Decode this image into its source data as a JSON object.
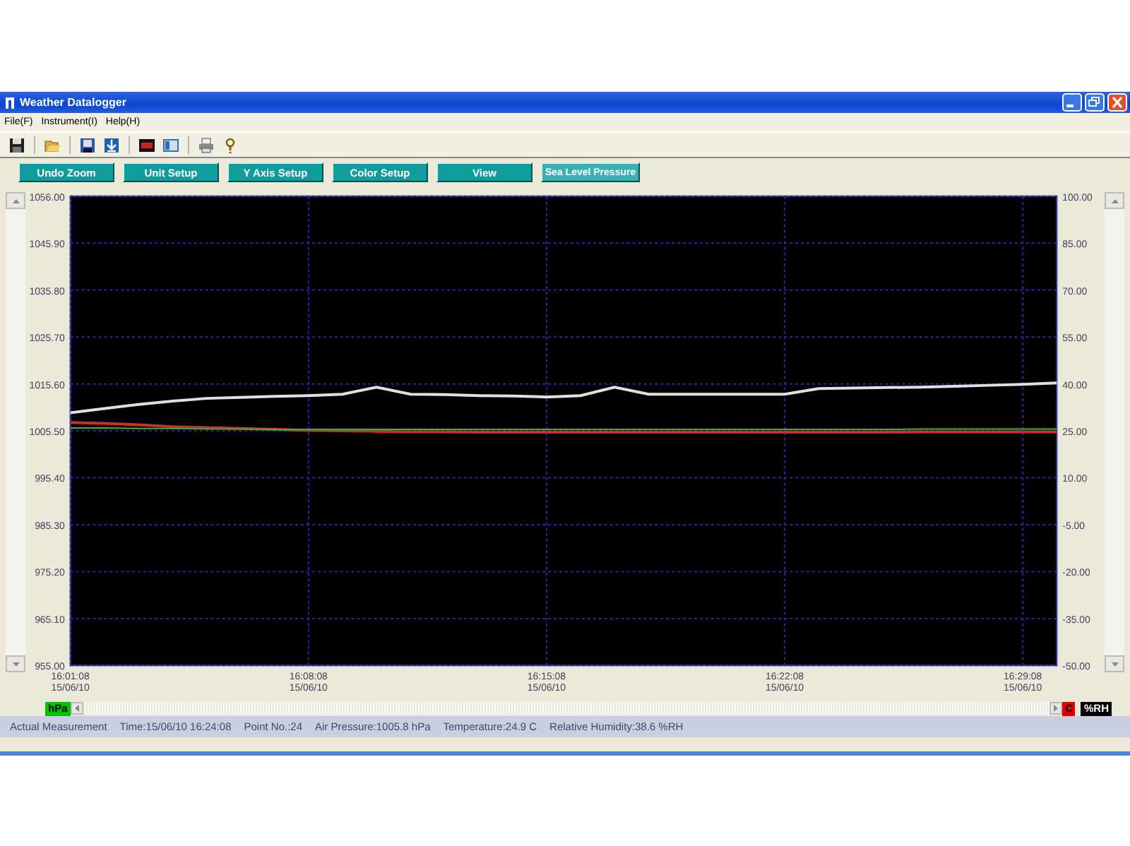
{
  "window": {
    "title": "Weather Datalogger",
    "controls": [
      {
        "kind": "minimize"
      },
      {
        "kind": "restore"
      },
      {
        "kind": "close"
      }
    ]
  },
  "menu": [
    "File(F)",
    "Instrument(I)",
    "Help(H)"
  ],
  "toolbar": [
    {
      "kind": "save"
    },
    {
      "kind": "open"
    },
    {
      "kind": "disk"
    },
    {
      "kind": "download"
    },
    {
      "kind": "display"
    },
    {
      "kind": "panels"
    },
    {
      "kind": "print"
    },
    {
      "kind": "help"
    }
  ],
  "buttons": [
    "Undo Zoom",
    "Unit Setup",
    "Y Axis Setup",
    "Color Setup",
    "View",
    "Sea Level Pressure"
  ],
  "chart": {
    "right_axis_ticks": [
      "100.00",
      "85.00",
      "70.00",
      "55.00",
      "40.00",
      "25.00",
      "10.00",
      "-5.00",
      "-20.00",
      "-35.00",
      "-50.00"
    ],
    "chart_data": {
      "type": "line",
      "grid": true,
      "ylim": [
        955,
        1056
      ],
      "categories": [
        "16:01:08\n15/06/10",
        null,
        null,
        null,
        null,
        null,
        null,
        "16:08:08\n15/06/10",
        null,
        null,
        null,
        null,
        null,
        null,
        "16:15:08\n15/06/10",
        null,
        null,
        null,
        null,
        null,
        null,
        "16:22:08\n15/06/10",
        null,
        null,
        null,
        null,
        null,
        null,
        "16:29:08\n15/06/10",
        null
      ],
      "yticks": [
        {
          "value": 1056,
          "label": "1056.00"
        },
        {
          "value": 1045.9,
          "label": "1045.90"
        },
        {
          "value": 1035.8,
          "label": "1035.80"
        },
        {
          "value": 1025.7,
          "label": "1025.70"
        },
        {
          "value": 1015.6,
          "label": "1015.60"
        },
        {
          "value": 1005.5,
          "label": "1005.50"
        },
        {
          "value": 995.4,
          "label": "995.40"
        },
        {
          "value": 985.3,
          "label": "985.30"
        },
        {
          "value": 975.2,
          "label": "975.20"
        },
        {
          "value": 965.1,
          "label": "965.10"
        },
        {
          "value": 955,
          "label": "955.00"
        }
      ],
      "series": [
        {
          "color": "#e0e0e0",
          "values": [
            1009.4,
            1010.3,
            1011.2,
            1011.9,
            1012.5,
            1012.7,
            1012.9,
            1013.1,
            1013.4,
            1014.9,
            1013.4,
            1013.3,
            1013.1,
            1013.0,
            1012.8,
            1013.1,
            1014.9,
            1013.4,
            1013.4,
            1013.4,
            1013.4,
            1013.4,
            1014.6,
            1014.7,
            1014.8,
            1014.9,
            1015.1,
            1015.3,
            1015.5,
            1015.8
          ]
        },
        {
          "color": "#c83030",
          "values": [
            1007.3,
            1007.1,
            1006.8,
            1006.4,
            1006.2,
            1006.0,
            1005.8,
            1005.6,
            1005.5,
            1005.4,
            1005.3,
            1005.3,
            1005.2,
            1005.2,
            1005.2,
            1005.2,
            1005.2,
            1005.2,
            1005.2,
            1005.2,
            1005.2,
            1005.2,
            1005.2,
            1005.2,
            1005.2,
            1005.3,
            1005.3,
            1005.3,
            1005.3,
            1005.3
          ]
        },
        {
          "color": "#40b040",
          "values": [
            1006.1,
            1006.1,
            1006.0,
            1006.0,
            1005.9,
            1005.9,
            1005.8,
            1005.8,
            1005.8,
            1005.8,
            1005.8,
            1005.8,
            1005.8,
            1005.8,
            1005.8,
            1005.8,
            1005.8,
            1005.8,
            1005.8,
            1005.8,
            1005.8,
            1005.8,
            1005.8,
            1005.8,
            1005.8,
            1005.9,
            1005.9,
            1005.9,
            1005.9,
            1005.9
          ]
        }
      ]
    }
  },
  "units": [
    {
      "label": "hPa",
      "color": "#00c000"
    },
    {
      "label": "C",
      "color": "#e00000"
    },
    {
      "label": "%RH",
      "color": "#000000"
    }
  ],
  "status_bar": [
    "Actual Measurement",
    "Time:15/06/10 16:24:08",
    "Point No.:24",
    "Air Pressure:1005.8 hPa",
    "Temperature:24.9 C",
    "Relative Humidity:38.6 %RH"
  ]
}
